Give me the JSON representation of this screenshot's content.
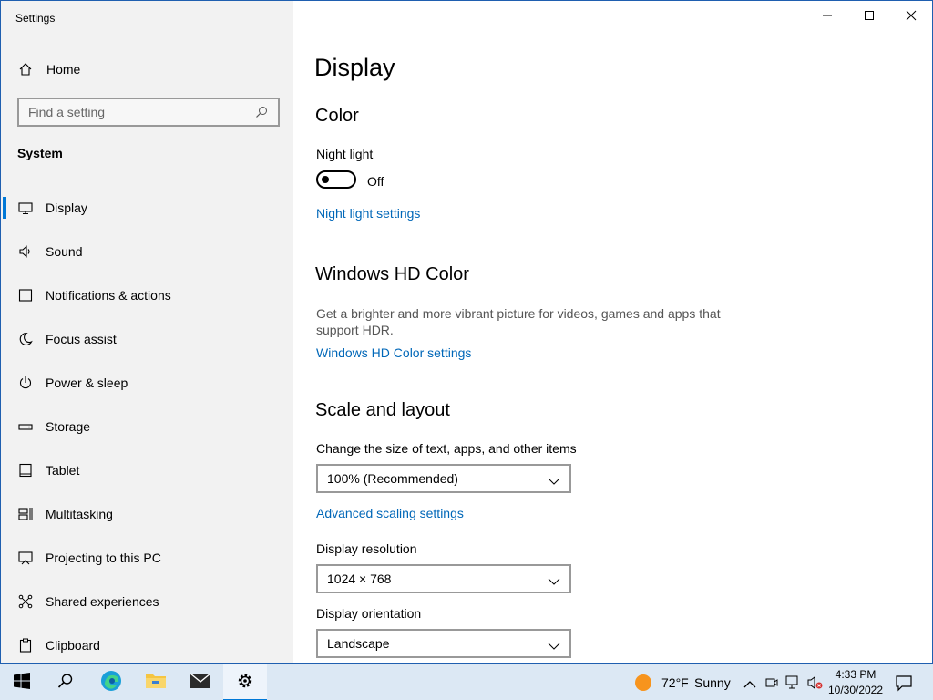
{
  "window": {
    "title": "Settings",
    "controls": [
      "minimize-icon",
      "maximize-icon",
      "close-icon"
    ]
  },
  "sidebar": {
    "home_label": "Home",
    "search_placeholder": "Find a setting",
    "section_heading": "System",
    "items": [
      {
        "label": "Display",
        "icon": "monitor-icon",
        "active": true
      },
      {
        "label": "Sound",
        "icon": "speaker-icon"
      },
      {
        "label": "Notifications & actions",
        "icon": "notifications-icon"
      },
      {
        "label": "Focus assist",
        "icon": "moon-icon"
      },
      {
        "label": "Power & sleep",
        "icon": "power-icon"
      },
      {
        "label": "Storage",
        "icon": "storage-icon"
      },
      {
        "label": "Tablet",
        "icon": "tablet-icon"
      },
      {
        "label": "Multitasking",
        "icon": "multitasking-icon"
      },
      {
        "label": "Projecting to this PC",
        "icon": "projecting-icon"
      },
      {
        "label": "Shared experiences",
        "icon": "shared-icon"
      },
      {
        "label": "Clipboard",
        "icon": "clipboard-icon"
      }
    ]
  },
  "main": {
    "title": "Display",
    "color": {
      "heading": "Color",
      "night_light_label": "Night light",
      "night_light_state": "Off",
      "night_light_on": false,
      "night_light_link": "Night light settings"
    },
    "hd_color": {
      "heading": "Windows HD Color",
      "description": "Get a brighter and more vibrant picture for videos, games and apps that support HDR.",
      "link": "Windows HD Color settings"
    },
    "scale": {
      "heading": "Scale and layout",
      "size_label": "Change the size of text, apps, and other items",
      "size_value": "100% (Recommended)",
      "advanced_link": "Advanced scaling settings",
      "resolution_label": "Display resolution",
      "resolution_value": "1024 × 768",
      "orientation_label": "Display orientation",
      "orientation_value": "Landscape"
    }
  },
  "taskbar": {
    "apps": [
      "start-icon",
      "search-icon",
      "edge-icon",
      "file-explorer-icon",
      "mail-icon",
      "settings-icon"
    ],
    "weather_temp": "72°F",
    "weather_desc": "Sunny",
    "time": "4:33 PM",
    "date": "10/30/2022"
  },
  "colors": {
    "accent": "#0078d7",
    "link": "#0067b8",
    "sidebar_bg": "#f2f2f2",
    "taskbar_bg": "#dce8f4"
  }
}
